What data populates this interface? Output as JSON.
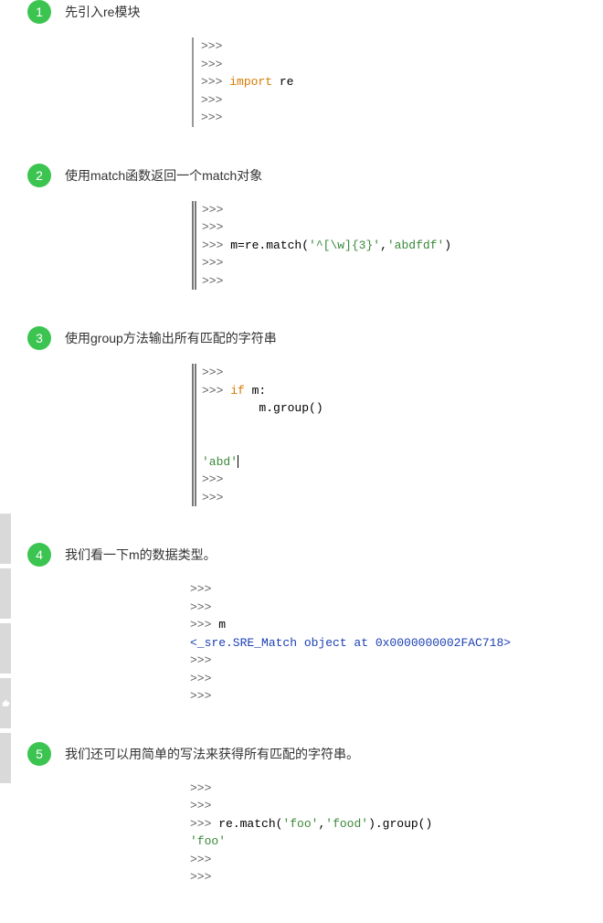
{
  "steps": [
    {
      "num": "1",
      "title": "先引入re模块",
      "code": [
        {
          "segs": [
            {
              "t": ">>>",
              "c": "tok-prompt"
            }
          ]
        },
        {
          "segs": [
            {
              "t": ">>>",
              "c": "tok-prompt"
            }
          ]
        },
        {
          "segs": [
            {
              "t": ">>> ",
              "c": "tok-prompt"
            },
            {
              "t": "import",
              "c": "tok-kw"
            },
            {
              "t": " re",
              "c": ""
            }
          ]
        },
        {
          "segs": [
            {
              "t": ">>>",
              "c": "tok-prompt"
            }
          ]
        },
        {
          "segs": [
            {
              "t": ">>>",
              "c": "tok-prompt"
            }
          ]
        }
      ],
      "style": "single"
    },
    {
      "num": "2",
      "title": "使用match函数返回一个match对象",
      "code": [
        {
          "segs": [
            {
              "t": ">>>",
              "c": "tok-prompt"
            }
          ]
        },
        {
          "segs": [
            {
              "t": ">>>",
              "c": "tok-prompt"
            }
          ]
        },
        {
          "segs": [
            {
              "t": ">>> ",
              "c": "tok-prompt"
            },
            {
              "t": "m=re.match(",
              "c": ""
            },
            {
              "t": "'^[\\w]{3}'",
              "c": "tok-str"
            },
            {
              "t": ",",
              "c": ""
            },
            {
              "t": "'abdfdf'",
              "c": "tok-str"
            },
            {
              "t": ")",
              "c": ""
            }
          ]
        },
        {
          "segs": [
            {
              "t": ">>>",
              "c": "tok-prompt"
            }
          ]
        },
        {
          "segs": [
            {
              "t": ">>>",
              "c": "tok-prompt"
            }
          ]
        }
      ],
      "style": "double"
    },
    {
      "num": "3",
      "title": "使用group方法输出所有匹配的字符串",
      "code": [
        {
          "segs": [
            {
              "t": ">>>",
              "c": "tok-prompt"
            }
          ]
        },
        {
          "segs": [
            {
              "t": ">>> ",
              "c": "tok-prompt"
            },
            {
              "t": "if",
              "c": "tok-kw"
            },
            {
              "t": " m:",
              "c": ""
            }
          ]
        },
        {
          "segs": [
            {
              "t": "        m.group()",
              "c": ""
            }
          ]
        },
        {
          "segs": [
            {
              "t": " ",
              "c": ""
            }
          ]
        },
        {
          "segs": [
            {
              "t": " ",
              "c": ""
            }
          ]
        },
        {
          "segs": [
            {
              "t": "'abd'",
              "c": "tok-str"
            },
            {
              "t": "|",
              "c": "cursor-mark"
            }
          ]
        },
        {
          "segs": [
            {
              "t": ">>>",
              "c": "tok-prompt"
            }
          ]
        },
        {
          "segs": [
            {
              "t": ">>>",
              "c": "tok-prompt"
            }
          ]
        }
      ],
      "style": "double"
    },
    {
      "num": "4",
      "title": "我们看一下m的数据类型。",
      "code": [
        {
          "segs": [
            {
              "t": ">>>",
              "c": "tok-prompt"
            }
          ]
        },
        {
          "segs": [
            {
              "t": ">>>",
              "c": "tok-prompt"
            }
          ]
        },
        {
          "segs": [
            {
              "t": ">>> ",
              "c": "tok-prompt"
            },
            {
              "t": "m",
              "c": ""
            }
          ]
        },
        {
          "segs": [
            {
              "t": "<_sre.SRE_Match object at 0x0000000002FAC718>",
              "c": "tok-out"
            }
          ]
        },
        {
          "segs": [
            {
              "t": ">>>",
              "c": "tok-prompt"
            }
          ]
        },
        {
          "segs": [
            {
              "t": ">>>",
              "c": "tok-prompt"
            }
          ]
        },
        {
          "segs": [
            {
              "t": ">>>",
              "c": "tok-prompt"
            }
          ]
        }
      ],
      "style": "none"
    },
    {
      "num": "5",
      "title": "我们还可以用简单的写法来获得所有匹配的字符串。",
      "code": [
        {
          "segs": [
            {
              "t": ">>>",
              "c": "tok-prompt"
            }
          ]
        },
        {
          "segs": [
            {
              "t": ">>>",
              "c": "tok-prompt"
            }
          ]
        },
        {
          "segs": [
            {
              "t": ">>> ",
              "c": "tok-prompt"
            },
            {
              "t": "re.match(",
              "c": ""
            },
            {
              "t": "'foo'",
              "c": "tok-str"
            },
            {
              "t": ",",
              "c": ""
            },
            {
              "t": "'food'",
              "c": "tok-str"
            },
            {
              "t": ").group()",
              "c": ""
            }
          ]
        },
        {
          "segs": [
            {
              "t": "'foo'",
              "c": "tok-str"
            }
          ]
        },
        {
          "segs": [
            {
              "t": ">>>",
              "c": "tok-prompt"
            }
          ]
        },
        {
          "segs": [
            {
              "t": ">>>",
              "c": "tok-prompt"
            }
          ]
        }
      ],
      "style": "none"
    }
  ]
}
